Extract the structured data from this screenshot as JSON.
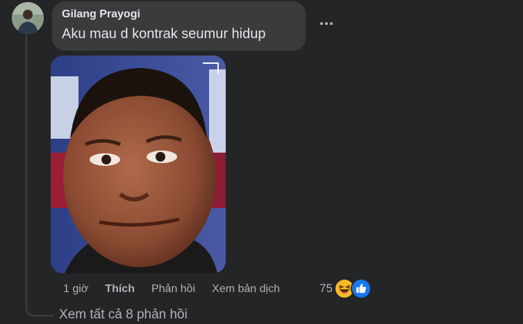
{
  "comment": {
    "author": "Gilang Prayogi",
    "text": "Aku mau d kontrak seumur hidup"
  },
  "actions": {
    "time": "1 giờ",
    "like": "Thích",
    "reply": "Phản hồi",
    "translate": "Xem bản dịch"
  },
  "reactions": {
    "count": "75",
    "icons": [
      "haha-icon",
      "like-icon"
    ],
    "like_color": "#1877f2",
    "haha_color": "#f7b928"
  },
  "view_replies": "Xem tất cả 8 phản hồi"
}
